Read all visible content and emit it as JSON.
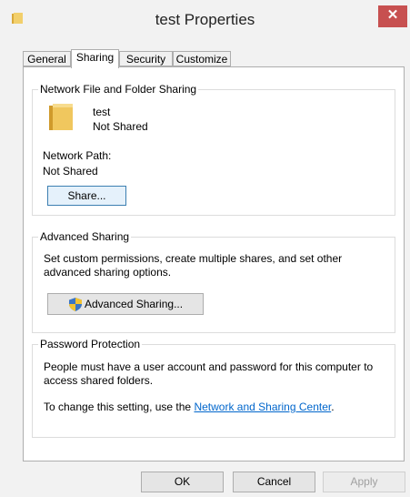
{
  "window": {
    "title": "test Properties",
    "close_glyph": "✕"
  },
  "tabs": [
    {
      "label": "General"
    },
    {
      "label": "Sharing"
    },
    {
      "label": "Security"
    },
    {
      "label": "Customize"
    }
  ],
  "network_sharing": {
    "group_title": "Network File and Folder Sharing",
    "folder_name": "test",
    "share_status": "Not Shared",
    "path_label": "Network Path:",
    "path_value": "Not Shared",
    "share_button": "Share..."
  },
  "advanced_sharing": {
    "group_title": "Advanced Sharing",
    "description_line1": "Set custom permissions, create multiple shares, and set other",
    "description_line2": "advanced sharing options.",
    "button_label": "Advanced Sharing..."
  },
  "password_protection": {
    "group_title": "Password Protection",
    "line1": "People must have a user account and password for this computer to",
    "line2": "access shared folders.",
    "change_prefix": "To change this setting, use the ",
    "link_text": "Network and Sharing Center",
    "change_suffix": "."
  },
  "footer": {
    "ok": "OK",
    "cancel": "Cancel",
    "apply": "Apply"
  },
  "icons": {
    "title_icon": "folder-icon",
    "folder_icon": "folder-icon",
    "shield_icon": "uac-shield-icon"
  },
  "colors": {
    "close_button": "#c75050",
    "link": "#0066cc",
    "folder": "#e8c05a"
  }
}
